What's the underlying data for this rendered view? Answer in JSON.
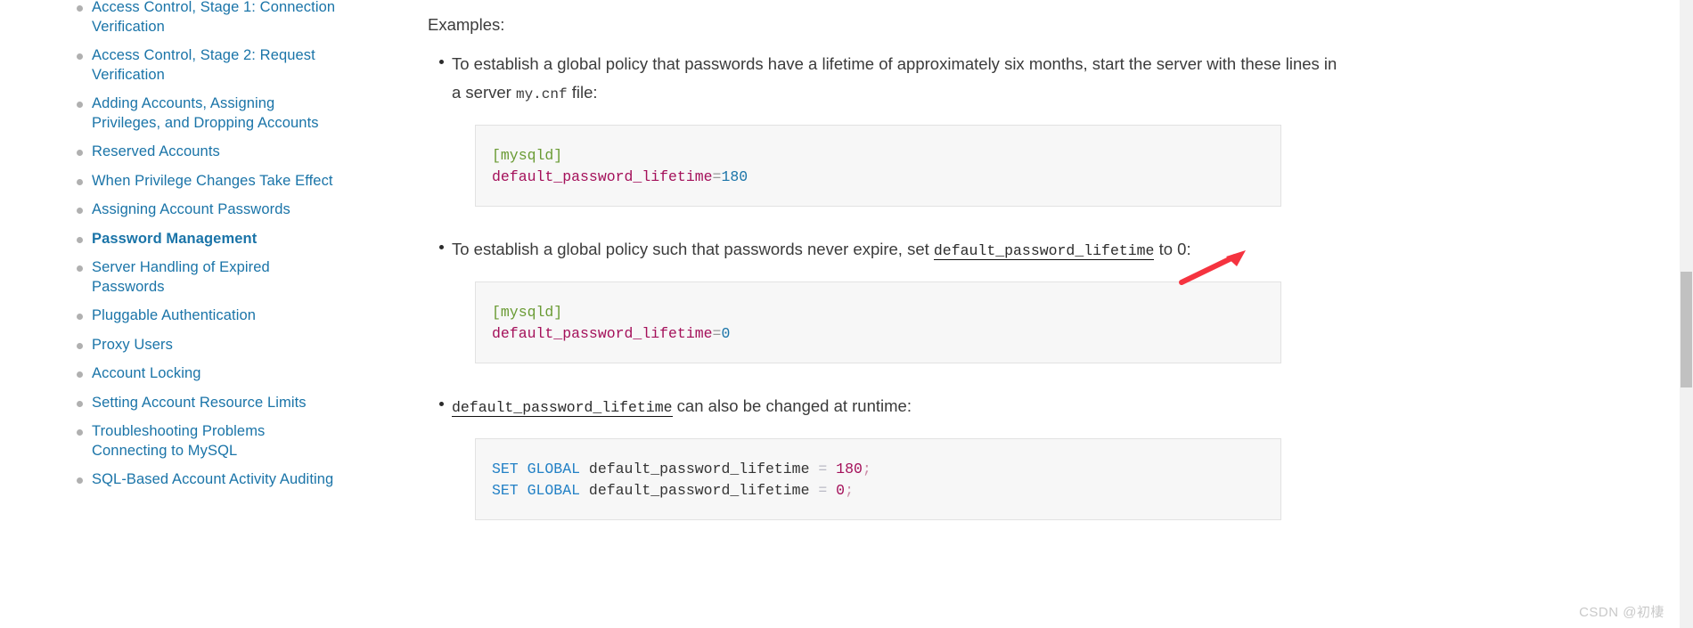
{
  "sidebar": {
    "items": [
      {
        "label": "Access Control, Stage 1: Connection Verification",
        "current": false
      },
      {
        "label": "Access Control, Stage 2: Request Verification",
        "current": false
      },
      {
        "label": "Adding Accounts, Assigning Privileges, and Dropping Accounts",
        "current": false
      },
      {
        "label": "Reserved Accounts",
        "current": false
      },
      {
        "label": "When Privilege Changes Take Effect",
        "current": false
      },
      {
        "label": "Assigning Account Passwords",
        "current": false
      },
      {
        "label": "Password Management",
        "current": true
      },
      {
        "label": "Server Handling of Expired Passwords",
        "current": false
      },
      {
        "label": "Pluggable Authentication",
        "current": false
      },
      {
        "label": "Proxy Users",
        "current": false
      },
      {
        "label": "Account Locking",
        "current": false
      },
      {
        "label": "Setting Account Resource Limits",
        "current": false
      },
      {
        "label": "Troubleshooting Problems Connecting to MySQL",
        "current": false
      },
      {
        "label": "SQL-Based Account Activity Auditing",
        "current": false
      }
    ],
    "link_color": "#1a74a8",
    "bullet_color": "#b0b0b0"
  },
  "main": {
    "lead": "Examples:",
    "item1": {
      "text_a": "To establish a global policy that passwords have a lifetime of approximately six months, start the server with these lines in a server ",
      "code_inline": "my.cnf",
      "text_b": " file:",
      "code": {
        "line1": {
          "section": "[mysqld]"
        },
        "line2": {
          "var": "default_password_lifetime",
          "eq": "=",
          "num": "180"
        }
      }
    },
    "item2": {
      "text_a": "To establish a global policy such that passwords never expire, set ",
      "code_link": "default_password_lifetime",
      "text_b": " to 0:",
      "code": {
        "line1": {
          "section": "[mysqld]"
        },
        "line2": {
          "var": "default_password_lifetime",
          "eq": "=",
          "num": "0"
        }
      }
    },
    "item3": {
      "code_link": "default_password_lifetime",
      "text_b": " can also be changed at runtime:",
      "code": {
        "line1": {
          "kw": "SET GLOBAL",
          "ident": " default_password_lifetime ",
          "op": "=",
          "num": " 180",
          "semi": ";"
        },
        "line2": {
          "kw": "SET GLOBAL",
          "ident": " default_password_lifetime ",
          "op": "=",
          "num": " 0",
          "semi": ";"
        }
      }
    }
  },
  "annotation": {
    "arrow_color": "#f5333f"
  },
  "watermark": {
    "text": "CSDN @初棲"
  },
  "colors": {
    "link": "#1a74a8",
    "code_section": "#6a9b34",
    "code_variable": "#a4105a",
    "code_keyword": "#2381c6",
    "code_number": "#1a74a8",
    "code_bg": "#f7f7f7",
    "code_border": "#e2e2e2",
    "scrollbar_track": "#f1f1f1",
    "scrollbar_thumb": "#c1c1c1"
  }
}
